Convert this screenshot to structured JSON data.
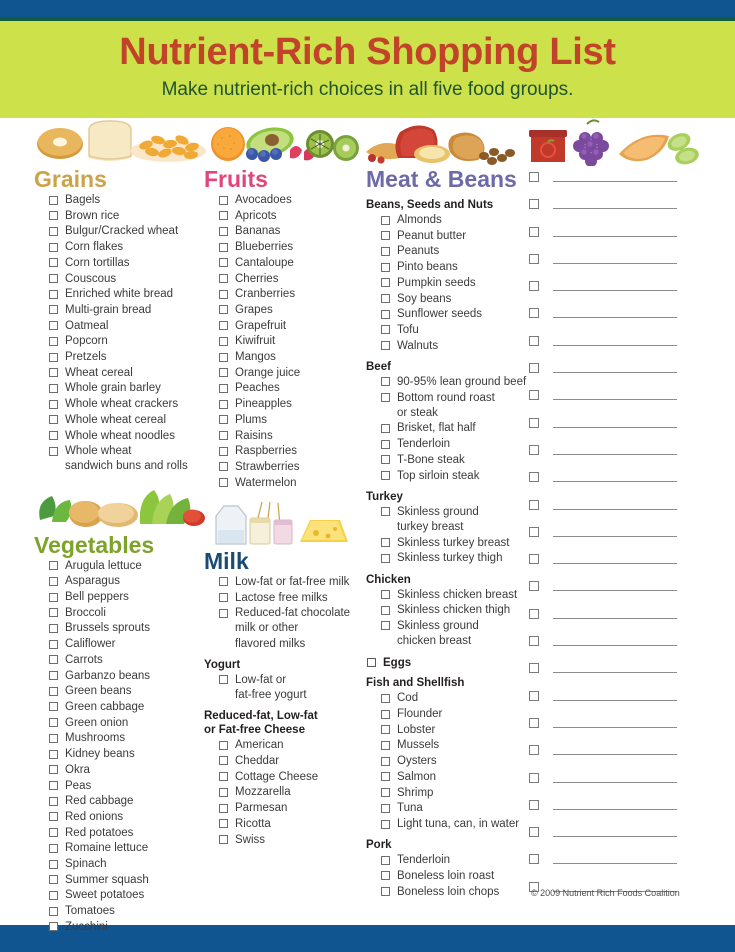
{
  "header": {
    "title": "Nutrient-Rich Shopping List",
    "subtitle": "Make nutrient-rich choices in all five food groups.",
    "title_color": "#c1432a",
    "subtitle_color": "#20532f",
    "band_color": "#cde24a",
    "frame_color": "#10558f"
  },
  "groups": {
    "grains": {
      "heading": "Grains",
      "color": "#cba34b",
      "art": "grains-bagel-bread-cereal-illustration",
      "items": [
        "Bagels",
        "Brown rice",
        "Bulgur/Cracked wheat",
        "Corn flakes",
        "Corn tortillas",
        "Couscous",
        "Enriched white bread",
        "Multi-grain bread",
        "Oatmeal",
        "Popcorn",
        "Pretzels",
        "Wheat cereal",
        "Whole grain barley",
        "Whole wheat crackers",
        "Whole wheat cereal",
        "Whole wheat noodles",
        "Whole wheat\nsandwich buns and rolls"
      ]
    },
    "vegetables": {
      "heading": "Vegetables",
      "color": "#7ea32a",
      "art": "vegetables-pepper-potato-lettuce-illustration",
      "items": [
        "Arugula lettuce",
        "Asparagus",
        "Bell peppers",
        "Broccoli",
        "Brussels sprouts",
        "Califlower",
        "Carrots",
        "Garbanzo beans",
        "Green beans",
        "Green cabbage",
        "Green onion",
        "Mushrooms",
        "Kidney beans",
        "Okra",
        "Peas",
        "Red cabbage",
        "Red onions",
        "Red potatoes",
        "Romaine lettuce",
        "Spinach",
        "Summer squash",
        "Sweet potatoes",
        "Tomatoes",
        "Zucchini"
      ]
    },
    "fruits": {
      "heading": "Fruits",
      "color": "#e0467c",
      "art": "fruits-orange-avocado-kiwi-berries-illustration",
      "items": [
        "Avocadoes",
        "Apricots",
        "Bananas",
        "Blueberries",
        "Cantaloupe",
        "Cherries",
        "Cranberries",
        "Grapes",
        "Grapefruit",
        "Kiwifruit",
        "Mangos",
        "Orange juice",
        "Peaches",
        "Pineapples",
        "Plums",
        "Raisins",
        "Raspberries",
        "Strawberries",
        "Watermelon"
      ]
    },
    "milk": {
      "heading": "Milk",
      "color": "#1b4b72",
      "art": "milk-bottle-cheese-yogurt-illustration",
      "items": [
        "Low-fat or fat-free milk",
        "Lactose free milks",
        "Reduced-fat chocolate\nmilk or other\nflavored milks"
      ],
      "subsections": [
        {
          "heading": "Yogurt",
          "items": [
            "Low-fat or\nfat-free yogurt"
          ]
        },
        {
          "heading": "Reduced-fat, Low-fat\nor Fat-free Cheese",
          "items": [
            "American",
            "Cheddar",
            "Cottage Cheese",
            "Mozzarella",
            "Parmesan",
            "Ricotta",
            "Swiss"
          ]
        }
      ]
    },
    "meat": {
      "heading": "Meat & Beans",
      "color": "#6e6aa8",
      "art": "meat-beans-ham-nuts-illustration",
      "subsections": [
        {
          "heading": "Beans, Seeds and Nuts",
          "items": [
            "Almonds",
            "Peanut butter",
            "Peanuts",
            "Pinto beans",
            "Pumpkin seeds",
            "Soy beans",
            "Sunflower seeds",
            "Tofu",
            "Walnuts"
          ]
        },
        {
          "heading": "Beef",
          "items": [
            "90-95% lean ground beef",
            "Bottom round roast\nor steak",
            "Brisket, flat half",
            "Tenderloin",
            "T-Bone steak",
            "Top sirloin steak"
          ]
        },
        {
          "heading": "Turkey",
          "items": [
            "Skinless ground\nturkey breast",
            "Skinless turkey breast",
            "Skinless turkey thigh"
          ]
        },
        {
          "heading": "Chicken",
          "items": [
            "Skinless chicken breast",
            "Skinless chicken thigh",
            "Skinless ground\nchicken breast"
          ]
        }
      ],
      "standalone_item": "Eggs",
      "subsections2": [
        {
          "heading": "Fish and Shellfish",
          "items": [
            "Cod",
            "Flounder",
            "Lobster",
            "Mussels",
            "Oysters",
            "Salmon",
            "Shrimp",
            "Tuna",
            "Light tuna, can, in water"
          ]
        },
        {
          "heading": "Pork",
          "items": [
            "Tenderloin",
            "Boneless loin roast",
            "Boneless loin chops"
          ]
        }
      ]
    },
    "blank": {
      "art": "jar-grapes-melon-cucumber-illustration",
      "line_count": 27
    }
  },
  "footer": {
    "copyright": "© 2009 Nutrient Rich Foods Coalition"
  }
}
